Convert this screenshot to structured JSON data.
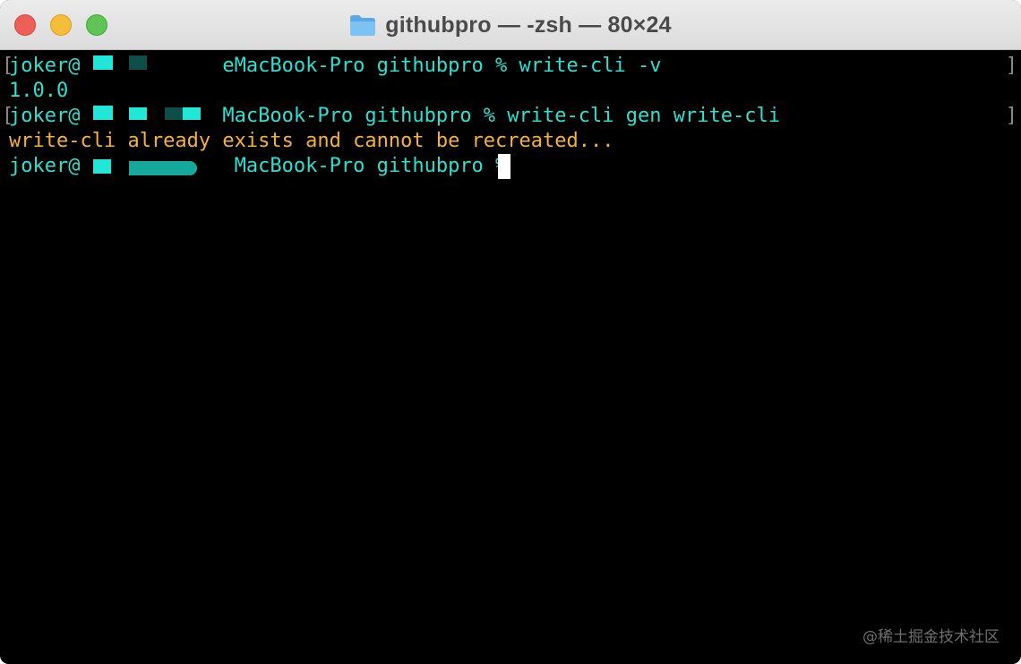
{
  "window": {
    "title": "githubpro — -zsh — 80×24",
    "folder_icon": "folder-icon"
  },
  "terminal": {
    "lines": [
      {
        "text": "joker@            eMacBook-Pro githubpro % write-cli -v",
        "kind": "prompt"
      },
      {
        "text": "1.0.0",
        "kind": "output"
      },
      {
        "text": "joker@            MacBook-Pro githubpro % write-cli gen write-cli",
        "kind": "prompt"
      },
      {
        "text": "write-cli already exists and cannot be recreated...",
        "kind": "warning"
      },
      {
        "text": "joker@             MacBook-Pro githubpro % ",
        "kind": "prompt"
      }
    ],
    "colors": {
      "prompt": "#2de0d0",
      "warning": "#f5b13a",
      "background": "#000000"
    }
  },
  "watermark": "@稀土掘金技术社区"
}
